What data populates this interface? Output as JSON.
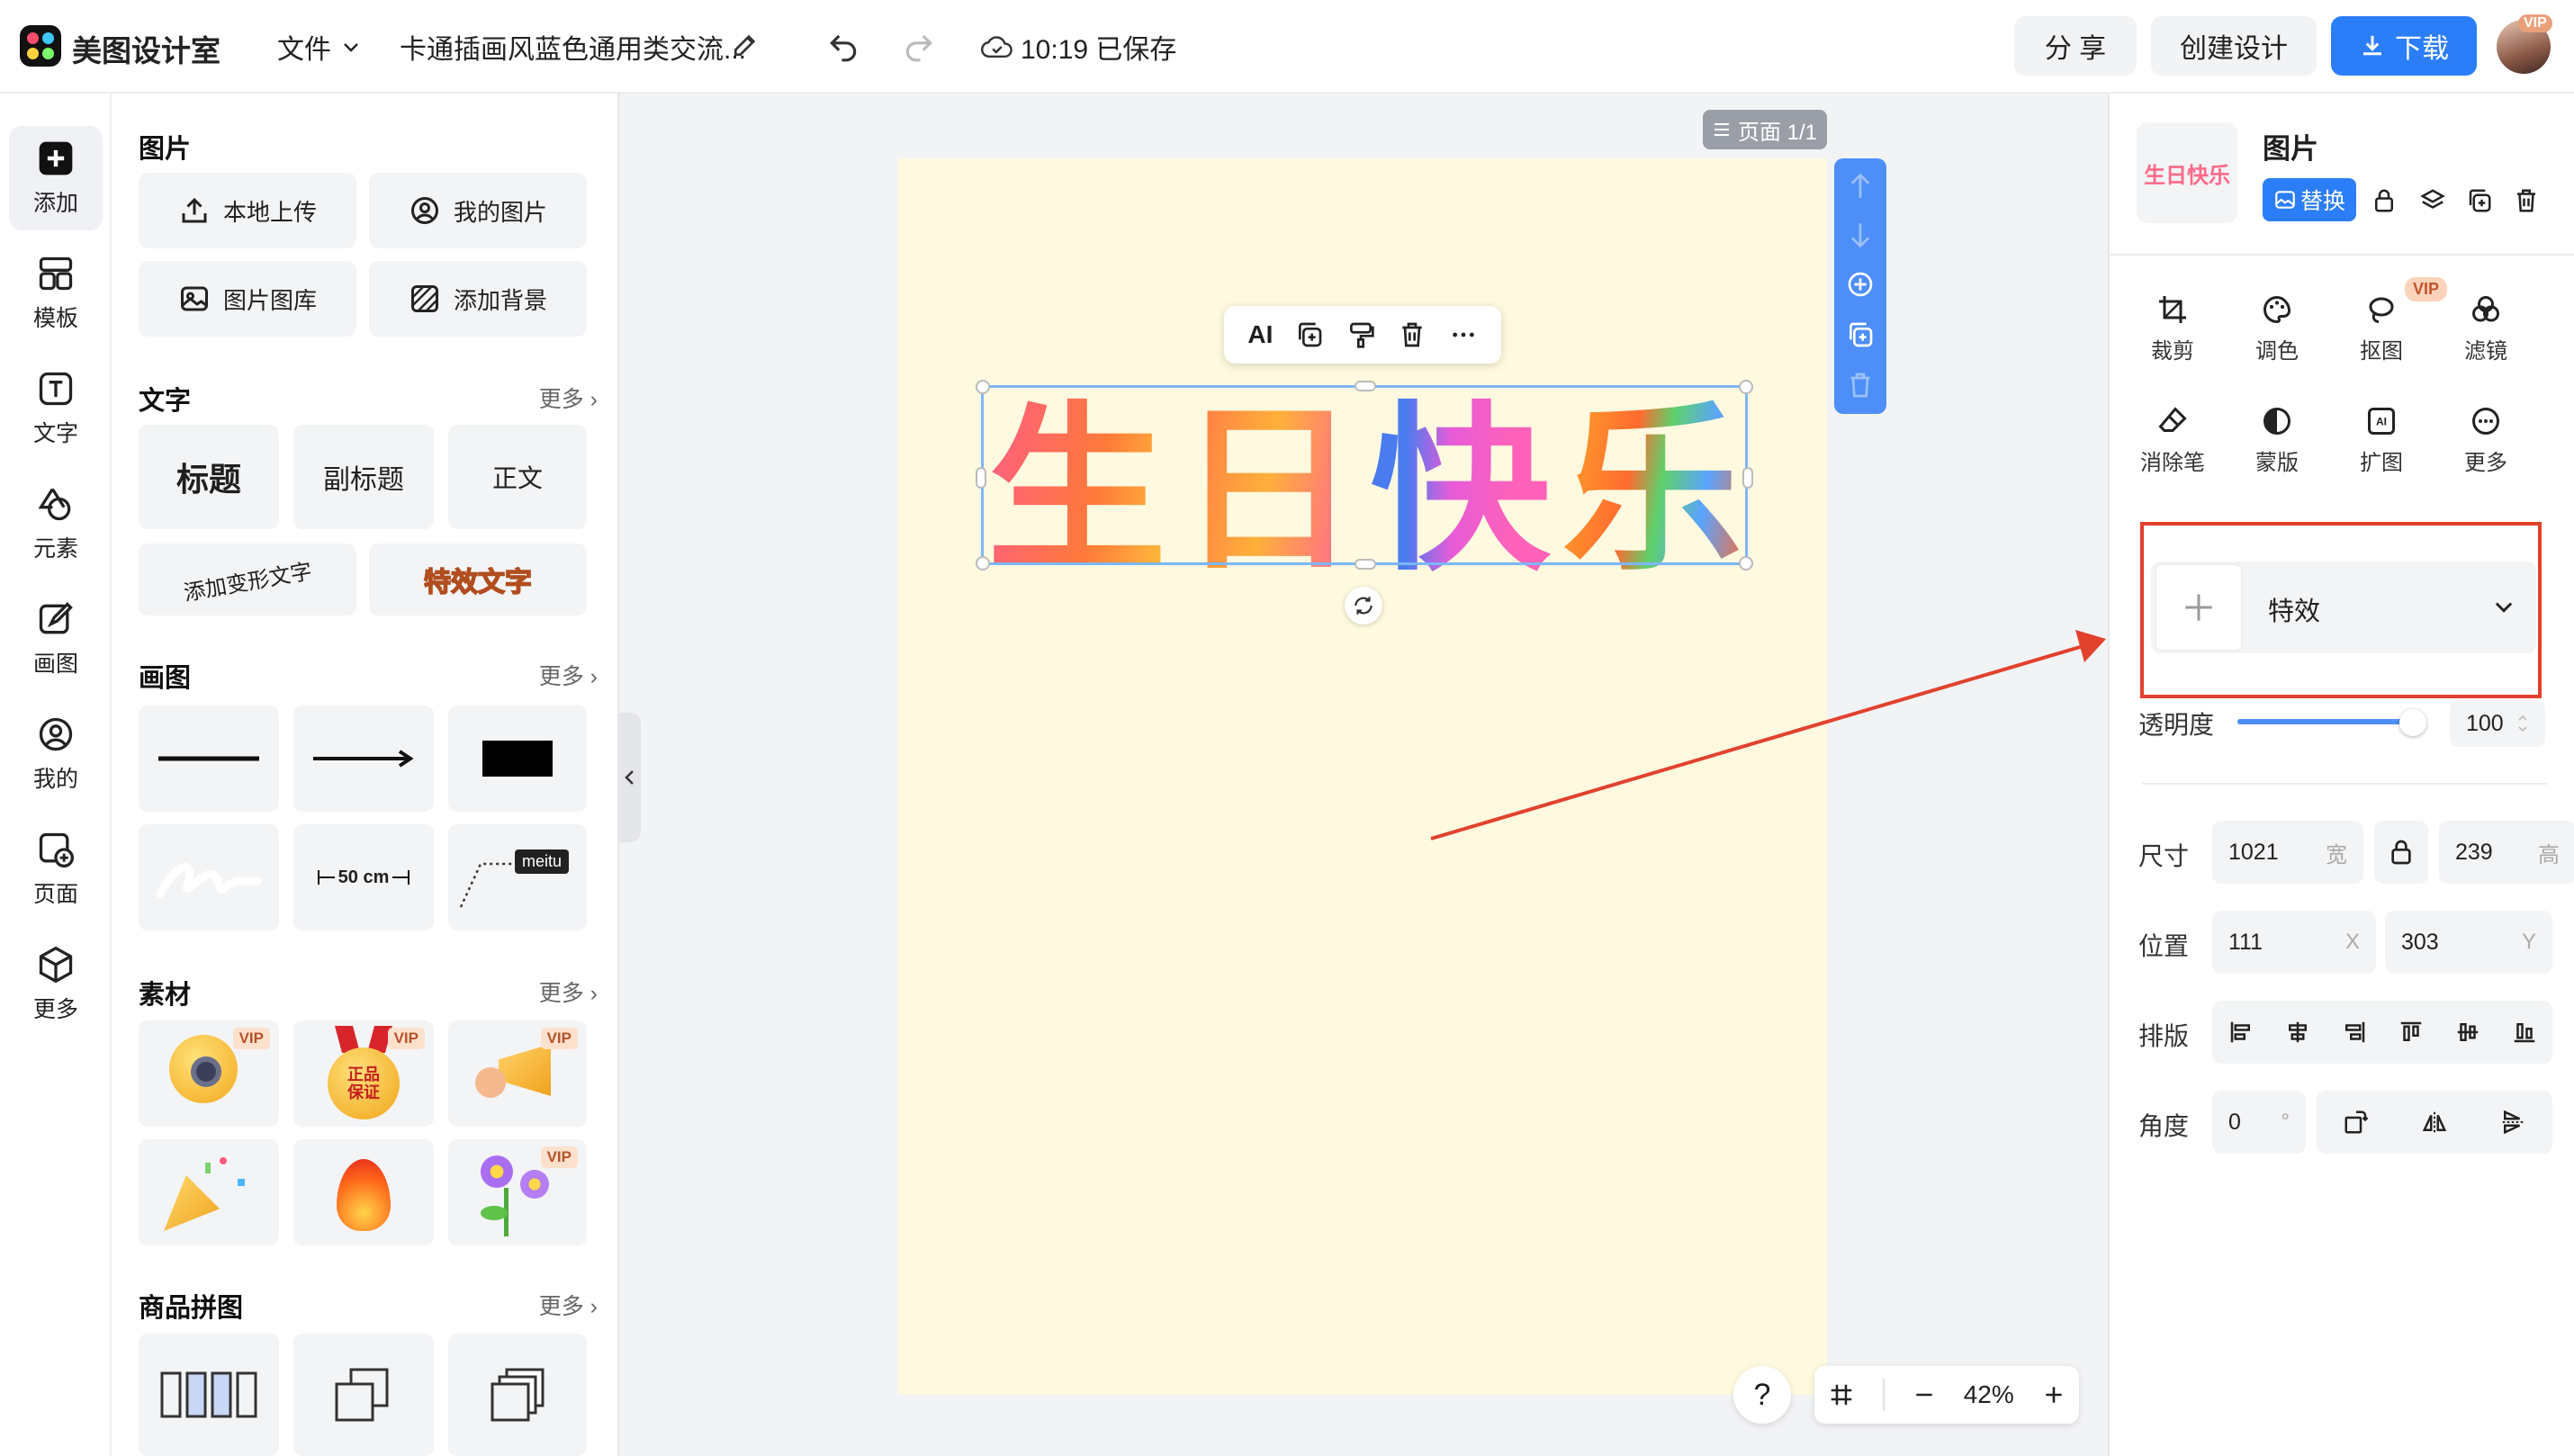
{
  "header": {
    "app_name": "美图设计室",
    "file_menu": "文件",
    "doc_title": "卡通插画风蓝色通用类交流...",
    "save_status": "10:19 已保存",
    "share_label": "分 享",
    "create_label": "创建设计",
    "download_label": "下载",
    "vip_badge": "VIP"
  },
  "rail": {
    "items": [
      {
        "label": "添加",
        "icon": "plus-icon"
      },
      {
        "label": "模板",
        "icon": "template-icon"
      },
      {
        "label": "文字",
        "icon": "text-icon"
      },
      {
        "label": "元素",
        "icon": "shapes-icon"
      },
      {
        "label": "画图",
        "icon": "draw-icon"
      },
      {
        "label": "我的",
        "icon": "user-icon"
      },
      {
        "label": "页面",
        "icon": "page-add-icon"
      },
      {
        "label": "更多",
        "icon": "cube-icon"
      }
    ]
  },
  "panel": {
    "images_title": "图片",
    "local_upload": "本地上传",
    "my_images": "我的图片",
    "gallery": "图片图库",
    "add_background": "添加背景",
    "text_title": "文字",
    "text_more": "更多",
    "heading": "标题",
    "subheading": "副标题",
    "body": "正文",
    "warp_text": "添加变形文字",
    "effect_text": "特效文字",
    "draw_title": "画图",
    "draw_more": "更多",
    "ruler_label": "50 cm",
    "meitu_label": "meitu",
    "material_title": "素材",
    "material_more": "更多",
    "medal_text": "正品保证",
    "vip": "VIP",
    "collage_title": "商品拼图",
    "collage_more": "更多"
  },
  "canvas": {
    "page_badge": "页面 1/1",
    "floating_ai": "AI",
    "birthday_chars": [
      "生",
      "日",
      "快",
      "乐"
    ]
  },
  "zoom": {
    "help": "?",
    "value": "42%"
  },
  "rpanel": {
    "title": "图片",
    "thumb_text": "生日快乐",
    "replace_label": "替换",
    "tools": [
      "裁剪",
      "调色",
      "抠图",
      "滤镜",
      "消除笔",
      "蒙版",
      "扩图",
      "更多"
    ],
    "vip": "VIP",
    "effect_label": "特效",
    "opacity_label": "透明度",
    "opacity_value": "100",
    "opacity_level": 1.0,
    "size_label": "尺寸",
    "width": "1021",
    "width_unit": "宽",
    "height": "239",
    "height_unit": "高",
    "position_label": "位置",
    "pos_x": "111",
    "x_unit": "X",
    "pos_y": "303",
    "y_unit": "Y",
    "layout_label": "排版",
    "angle_label": "角度",
    "angle": "0",
    "degree": "°"
  },
  "colors": {
    "accent_blue": "#2c7ef8",
    "page_bg": "#fff9df",
    "highlight_red": "#e2412d"
  }
}
